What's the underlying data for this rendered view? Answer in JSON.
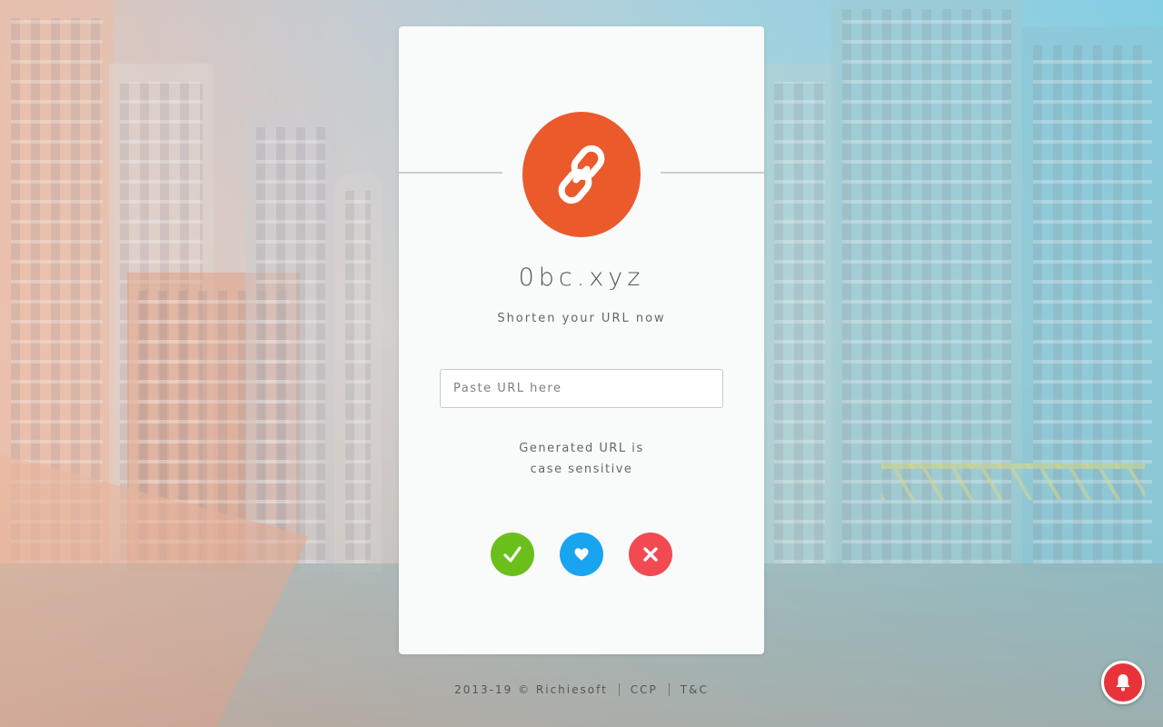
{
  "brand": {
    "name": "0bc.xyz",
    "tagline": "Shorten your URL now",
    "logo_icon": "link-icon",
    "logo_color": "#ea5a2b"
  },
  "form": {
    "url_placeholder": "Paste URL here",
    "url_value": "",
    "note_line1": "Generated URL is",
    "note_line2": "case sensitive"
  },
  "actions": [
    {
      "icon": "checkmark-icon",
      "color": "#6bbf1a"
    },
    {
      "icon": "heart-icon",
      "color": "#18a4ef"
    },
    {
      "icon": "close-icon",
      "color": "#f14a52"
    }
  ],
  "footer": {
    "copyright": "2013-19 © Richiesoft",
    "link1": "CCP",
    "link2": "T&C"
  },
  "notification": {
    "icon": "bell-icon",
    "color": "#e8333a"
  }
}
